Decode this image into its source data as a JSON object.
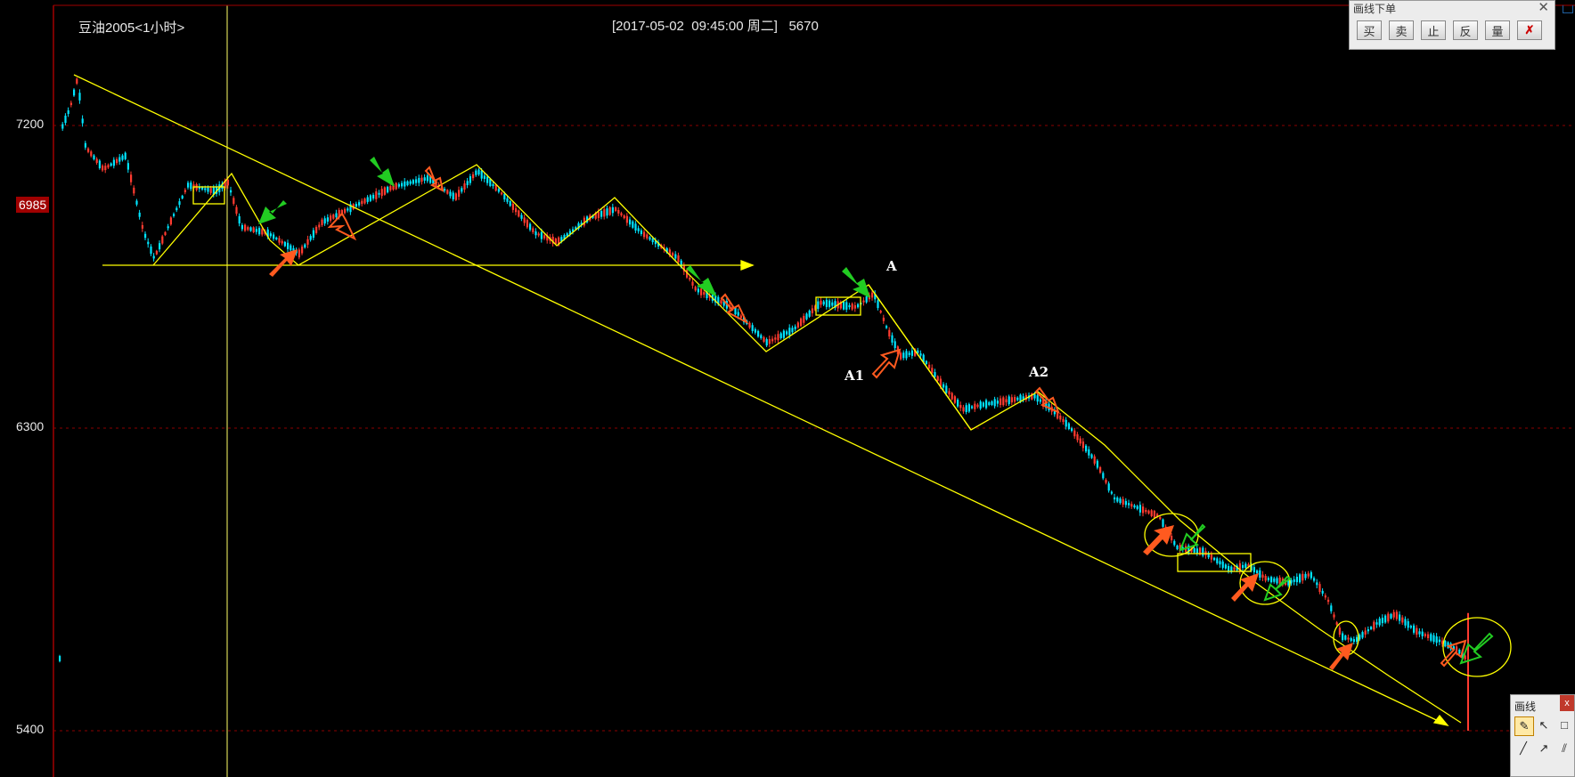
{
  "chart": {
    "title": "豆油2005<1小时>",
    "info": "[2017-05-02  09:45:00 周二]   5670",
    "current_price_label": "6985"
  },
  "chart_data": {
    "type": "candlestick",
    "title": "豆油2005<1小时>",
    "ytick_labels": [
      "7200",
      "6300",
      "5400"
    ],
    "ylim": [
      5270,
      7350
    ],
    "current_price": 6985,
    "annotations": [
      "A",
      "A1",
      "A2"
    ],
    "grid": "horizontal dashed red lines",
    "colors": {
      "up": "#ff3b30",
      "down": "#00e5ff",
      "trendline": "#ffff00",
      "bg": "#000000"
    }
  },
  "order_panel": {
    "title": "画线下单",
    "close": "✕",
    "buttons": [
      "买",
      "卖",
      "止",
      "反",
      "量",
      "✗"
    ]
  },
  "draw_tools": {
    "title": "画线",
    "close": "x"
  }
}
